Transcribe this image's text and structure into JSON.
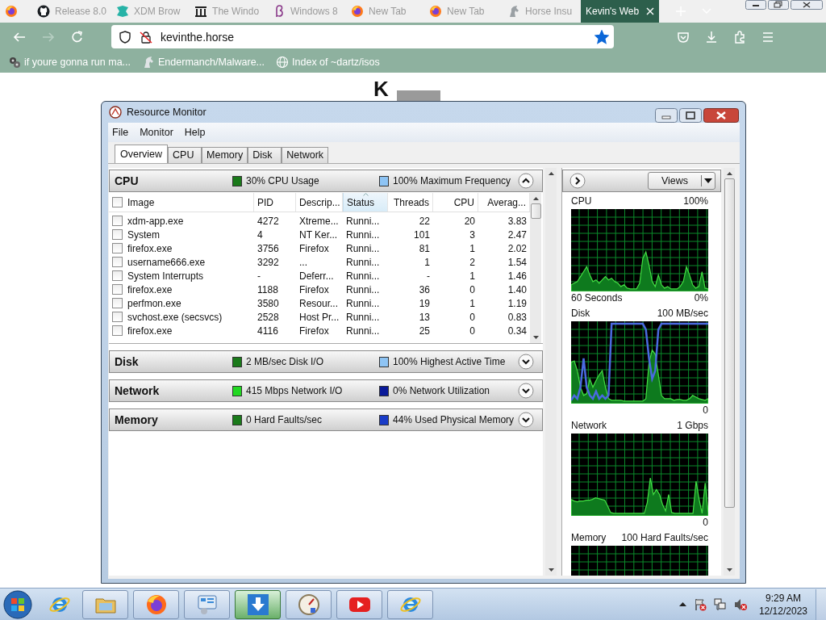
{
  "browser": {
    "tabs": [
      {
        "kind": "firefox",
        "selected": false
      },
      {
        "kind": "github",
        "title": "Release 8.0",
        "selected": false
      },
      {
        "kind": "xdm",
        "title": "XDM Brow",
        "selected": false
      },
      {
        "kind": "building",
        "title": "The Windo",
        "selected": false
      },
      {
        "kind": "beta",
        "title": "Windows 8",
        "selected": false
      },
      {
        "kind": "firefox",
        "title": "New Tab",
        "selected": false
      },
      {
        "kind": "firefox",
        "title": "New Tab",
        "selected": false
      },
      {
        "kind": "horse",
        "title": "Horse Insu",
        "selected": false
      },
      {
        "kind": "none",
        "title": "Kevin's Web",
        "selected": true
      }
    ],
    "address": {
      "url": "kevinthe.horse",
      "bookmarked": true
    },
    "bookmarks": [
      {
        "kind": "script",
        "title": "if youre gonna run ma..."
      },
      {
        "kind": "horse",
        "title": "Endermanch/Malware..."
      },
      {
        "kind": "globe",
        "title": "Index of ~dartz/isos"
      }
    ]
  },
  "page": {
    "heading": "K"
  },
  "resource_monitor": {
    "title": "Resource Monitor",
    "menu": [
      "File",
      "Monitor",
      "Help"
    ],
    "tabs": [
      {
        "label": "Overview",
        "selected": true
      },
      {
        "label": "CPU",
        "selected": false
      },
      {
        "label": "Memory",
        "selected": false
      },
      {
        "label": "Disk",
        "selected": false
      },
      {
        "label": "Network",
        "selected": false
      }
    ],
    "sections": [
      {
        "title": "CPU",
        "expanded": true,
        "metrics": [
          {
            "text": "30% CPU Usage",
            "color": "#1a7a1a"
          },
          {
            "text": "100% Maximum Frequency",
            "color": "#8ec4f4"
          }
        ]
      },
      {
        "title": "Disk",
        "expanded": false,
        "metrics": [
          {
            "text": "2 MB/sec Disk I/O",
            "color": "#1a7a1a"
          },
          {
            "text": "100% Highest Active Time",
            "color": "#8ec4f4"
          }
        ]
      },
      {
        "title": "Network",
        "expanded": false,
        "metrics": [
          {
            "text": "415 Mbps Network I/O",
            "color": "#22d822"
          },
          {
            "text": "0% Network Utilization",
            "color": "#0a1a9a"
          }
        ]
      },
      {
        "title": "Memory",
        "expanded": false,
        "metrics": [
          {
            "text": "0 Hard Faults/sec",
            "color": "#1a7a1a"
          },
          {
            "text": "44% Used Physical Memory",
            "color": "#1a3cc8"
          }
        ]
      }
    ],
    "process_table": {
      "columns": [
        {
          "label": "Image",
          "sorted": false
        },
        {
          "label": "PID",
          "sorted": false
        },
        {
          "label": "Descrip...",
          "sorted": false
        },
        {
          "label": "Status",
          "sorted": true
        },
        {
          "label": "Threads",
          "sorted": false
        },
        {
          "label": "CPU",
          "sorted": false
        },
        {
          "label": "Averag...",
          "sorted": false
        }
      ],
      "rows": [
        {
          "checked": false,
          "cells": [
            "xdm-app.exe",
            "4272",
            "Xtreme...",
            "Runni...",
            "22",
            "20",
            "3.83"
          ]
        },
        {
          "checked": false,
          "cells": [
            "System",
            "4",
            "NT Ker...",
            "Runni...",
            "101",
            "3",
            "2.47"
          ]
        },
        {
          "checked": false,
          "cells": [
            "firefox.exe",
            "3756",
            "Firefox",
            "Runni...",
            "81",
            "1",
            "2.02"
          ]
        },
        {
          "checked": false,
          "cells": [
            "username666.exe",
            "3292",
            "...",
            "Runni...",
            "1",
            "2",
            "1.54"
          ]
        },
        {
          "checked": false,
          "cells": [
            "System Interrupts",
            "-",
            "Deferr...",
            "Runni...",
            "-",
            "1",
            "1.46"
          ]
        },
        {
          "checked": false,
          "cells": [
            "firefox.exe",
            "1188",
            "Firefox",
            "Runni...",
            "36",
            "0",
            "1.40"
          ]
        },
        {
          "checked": false,
          "cells": [
            "perfmon.exe",
            "3580",
            "Resour...",
            "Runni...",
            "19",
            "1",
            "1.19"
          ]
        },
        {
          "checked": false,
          "cells": [
            "svchost.exe (secsvcs)",
            "2528",
            "Host Pr...",
            "Runni...",
            "13",
            "0",
            "0.83"
          ]
        },
        {
          "checked": false,
          "cells": [
            "firefox.exe",
            "4116",
            "Firefox",
            "Runni...",
            "25",
            "0",
            "0.34"
          ]
        }
      ]
    },
    "graph_panel": {
      "views_button": "Views",
      "graphs": [
        {
          "kind": "cpu",
          "title": "CPU",
          "max": "100%",
          "time": "60 Seconds",
          "min": "0%"
        },
        {
          "kind": "disk",
          "title": "Disk",
          "max": "100 MB/sec",
          "min": "0"
        },
        {
          "kind": "network",
          "title": "Network",
          "max": "1 Gbps",
          "min": "0"
        },
        {
          "kind": "memory",
          "title": "Memory",
          "max": "100 Hard Faults/sec"
        }
      ]
    }
  },
  "taskbar": {
    "items": [
      {
        "kind": "ie",
        "selected": false
      },
      {
        "kind": "explorer",
        "selected": false
      },
      {
        "kind": "firefox",
        "selected": false
      },
      {
        "kind": "control",
        "selected": false
      },
      {
        "kind": "download",
        "selected": true
      },
      {
        "kind": "gauge",
        "selected": false
      },
      {
        "kind": "video",
        "selected": false
      },
      {
        "kind": "ie",
        "selected": false
      }
    ],
    "clock": {
      "time": "9:29 AM",
      "date": "12/12/2023"
    }
  }
}
